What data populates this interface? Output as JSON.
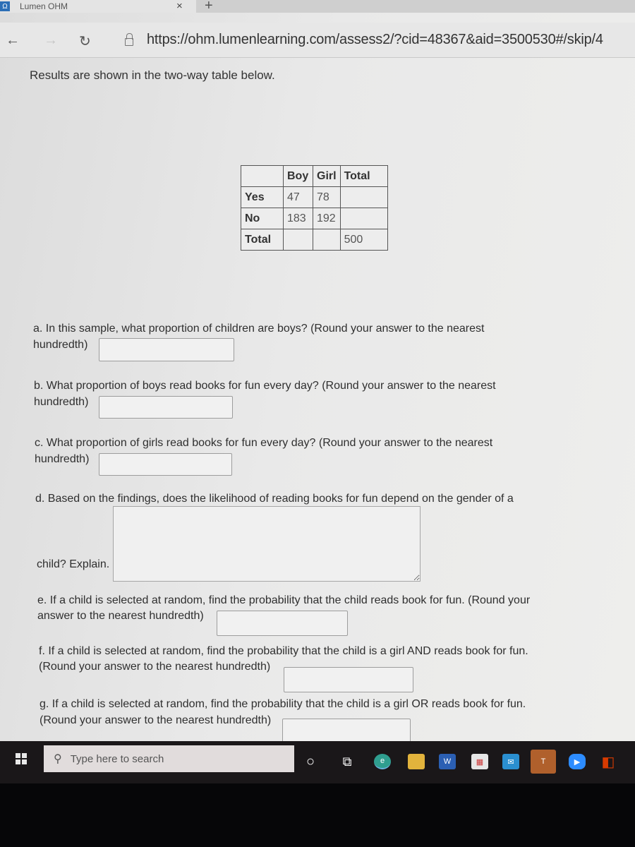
{
  "browser": {
    "tab_title": "Lumen OHM",
    "favicon": "Ω",
    "close_glyph": "×",
    "new_tab_glyph": "+",
    "back_glyph": "←",
    "forward_glyph": "→",
    "reload_glyph": "↻",
    "url": "https://ohm.lumenlearning.com/assess2/?cid=48367&aid=3500530#/skip/4"
  },
  "page": {
    "intro": "Results are shown in the two-way table below.",
    "table": {
      "headers": [
        "",
        "Boy",
        "Girl",
        "Total"
      ],
      "rows": [
        [
          "Yes",
          "47",
          "78",
          ""
        ],
        [
          "No",
          "183",
          "192",
          ""
        ],
        [
          "Total",
          "",
          "",
          "500"
        ]
      ]
    },
    "questions": [
      {
        "id": "a",
        "line1": "a. In this sample, what proportion of children are boys? (Round your answer to the nearest",
        "line2": "hundredth)",
        "value": ""
      },
      {
        "id": "b",
        "line1": "b. What proportion of boys read books for fun every day? (Round your answer to the nearest",
        "line2": "hundredth)",
        "value": ""
      },
      {
        "id": "c",
        "line1": "c. What proportion of girls read books for fun every day? (Round your answer to the nearest",
        "line2": "hundredth)",
        "value": ""
      },
      {
        "id": "d",
        "line1": "d. Based on the findings, does the likelihood of reading books for fun depend on the gender of a",
        "line2": "child? Explain.",
        "value": ""
      },
      {
        "id": "e",
        "line1": "e. If a child is selected at random, find the probability that the child reads book for fun. (Round your",
        "line2": "answer to the nearest hundredth)",
        "value": ""
      },
      {
        "id": "f",
        "line1": "f. If a child is selected at random, find the probability that the child is a girl AND reads book for fun.",
        "line2": "(Round your answer to the nearest hundredth)",
        "value": ""
      },
      {
        "id": "g",
        "line1": "g. If a child is selected at random, find the probability that the child is a girl OR reads book for fun.",
        "line2": "(Round your answer to the nearest hundredth)",
        "value": ""
      }
    ]
  },
  "taskbar": {
    "search_placeholder": "Type here to search",
    "search_glyph": "⚲",
    "apps": [
      {
        "name": "cortana",
        "glyph": "○",
        "color": "#1a1719"
      },
      {
        "name": "task-view",
        "glyph": "⧉",
        "color": "#1a1719"
      },
      {
        "name": "edge",
        "glyph": "e",
        "color": "#2f9e8f"
      },
      {
        "name": "file-explorer",
        "glyph": "",
        "color": "#e2b33c"
      },
      {
        "name": "word",
        "glyph": "W",
        "color": "#2b5fb3"
      },
      {
        "name": "store",
        "glyph": "▦",
        "color": "#e6e6e6"
      },
      {
        "name": "mail",
        "glyph": "✉",
        "color": "#2a8fd0"
      },
      {
        "name": "teams",
        "glyph": "T",
        "color": "#5059c9"
      },
      {
        "name": "zoom",
        "glyph": "▶",
        "color": "#2d8cff"
      },
      {
        "name": "office",
        "glyph": "◧",
        "color": "#d83b01"
      }
    ]
  }
}
